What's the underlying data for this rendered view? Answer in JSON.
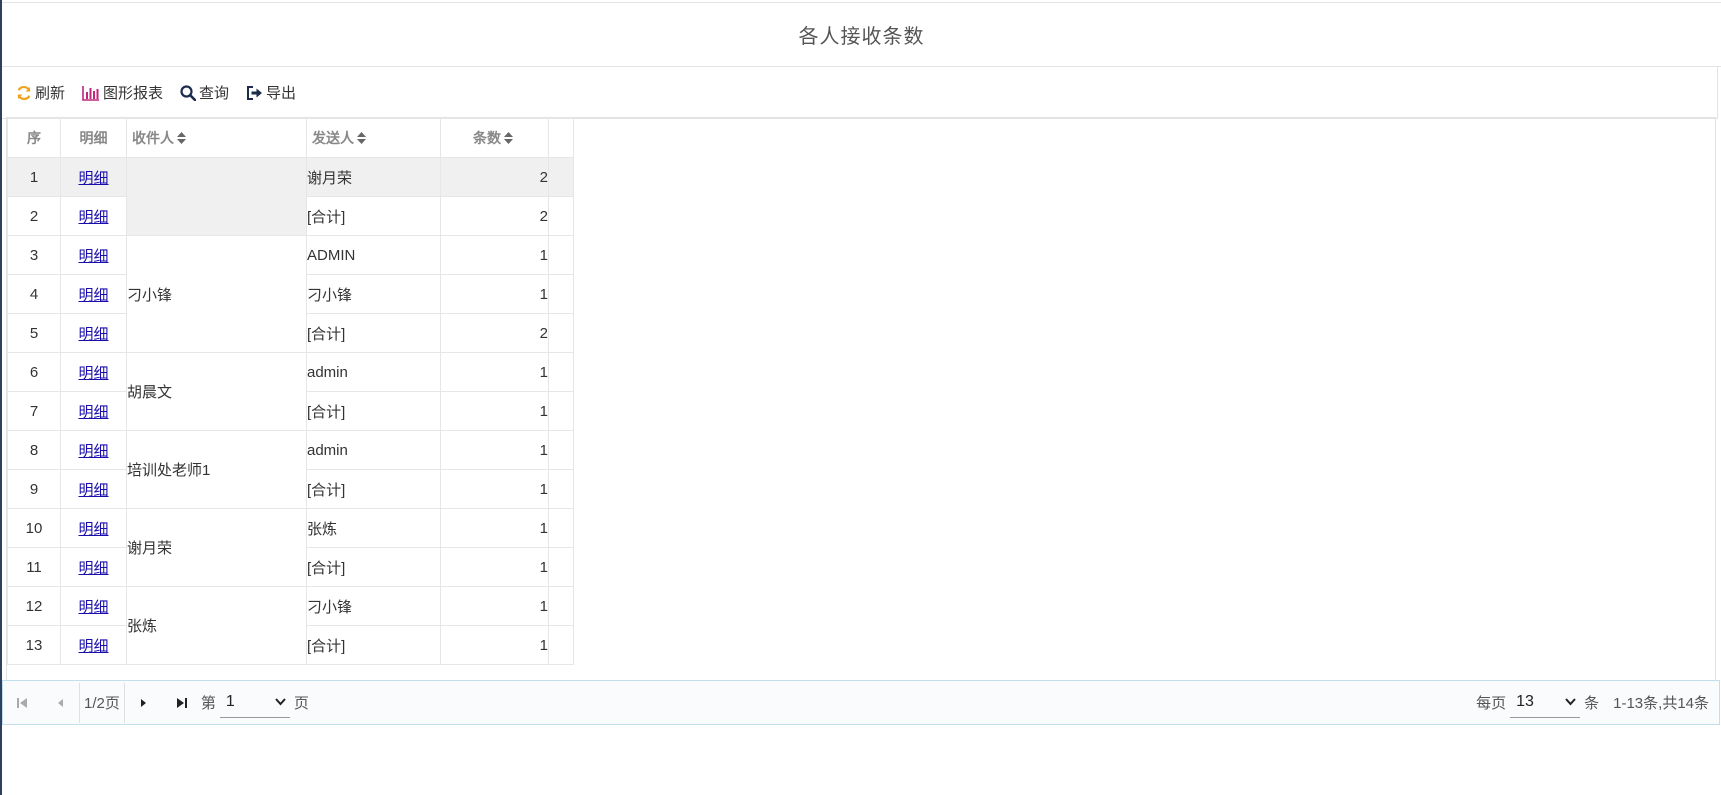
{
  "page": {
    "title": "各人接收条数"
  },
  "toolbar": {
    "refresh_label": "刷新",
    "chart_label": "图形报表",
    "query_label": "查询",
    "export_label": "导出"
  },
  "table": {
    "headers": {
      "seq": "序",
      "detail": "明细",
      "receiver": "收件人",
      "sender": "发送人",
      "count": "条数"
    },
    "groups": [
      {
        "receiver": "",
        "rows": [
          {
            "seq": "1",
            "detail": "明细",
            "sender": "谢月荣",
            "count": "2"
          },
          {
            "seq": "2",
            "detail": "明细",
            "sender": "[合计]",
            "count": "2"
          }
        ]
      },
      {
        "receiver": "刁小锋",
        "rows": [
          {
            "seq": "3",
            "detail": "明细",
            "sender": "ADMIN",
            "count": "1"
          },
          {
            "seq": "4",
            "detail": "明细",
            "sender": "刁小锋",
            "count": "1"
          },
          {
            "seq": "5",
            "detail": "明细",
            "sender": "[合计]",
            "count": "2"
          }
        ]
      },
      {
        "receiver": "胡晨文",
        "rows": [
          {
            "seq": "6",
            "detail": "明细",
            "sender": "admin",
            "count": "1"
          },
          {
            "seq": "7",
            "detail": "明细",
            "sender": "[合计]",
            "count": "1"
          }
        ]
      },
      {
        "receiver": "培训处老师1",
        "rows": [
          {
            "seq": "8",
            "detail": "明细",
            "sender": "admin",
            "count": "1"
          },
          {
            "seq": "9",
            "detail": "明细",
            "sender": "[合计]",
            "count": "1"
          }
        ]
      },
      {
        "receiver": "谢月荣",
        "rows": [
          {
            "seq": "10",
            "detail": "明细",
            "sender": "张炼",
            "count": "1"
          },
          {
            "seq": "11",
            "detail": "明细",
            "sender": "[合计]",
            "count": "1"
          }
        ]
      },
      {
        "receiver": "张炼",
        "rows": [
          {
            "seq": "12",
            "detail": "明细",
            "sender": "刁小锋",
            "count": "1"
          },
          {
            "seq": "13",
            "detail": "明细",
            "sender": "[合计]",
            "count": "1"
          }
        ]
      }
    ]
  },
  "pager": {
    "page_info": "1/2页",
    "page_prefix": "第",
    "current_page": "1",
    "page_suffix": "页",
    "per_page_prefix": "每页",
    "per_page": "13",
    "per_page_suffix": "条",
    "summary": "1-13条,共14条"
  },
  "colors": {
    "refresh": "#f0a21f",
    "chart": "#c0267a",
    "accent": "#1a0dab"
  }
}
